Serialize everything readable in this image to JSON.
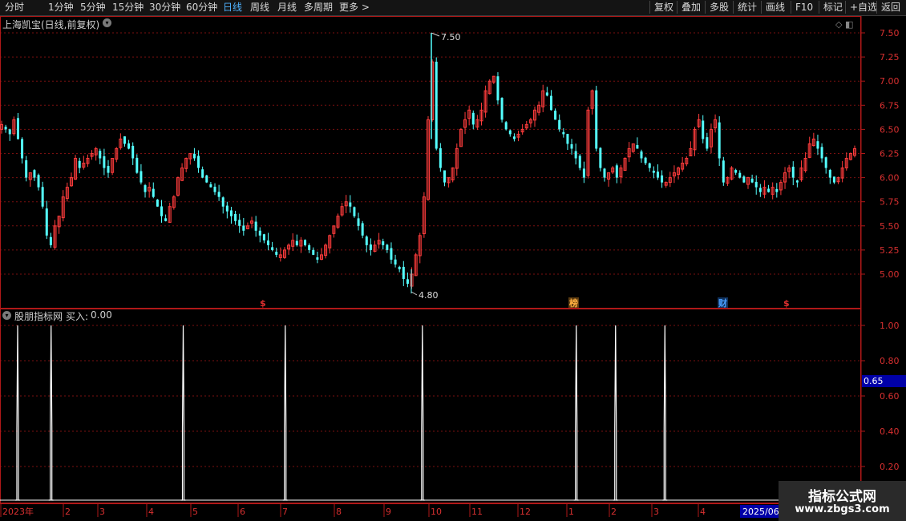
{
  "toolbar": {
    "periods": [
      "分时",
      "1分钟",
      "5分钟",
      "15分钟",
      "30分钟",
      "60分钟",
      "日线",
      "周线",
      "月线",
      "多周期",
      "更多 >"
    ],
    "active_period": "日线",
    "actions": [
      "复权",
      "叠加",
      "多股",
      "统计",
      "画线",
      "F10",
      "标记",
      "+自选",
      "返回"
    ]
  },
  "stock": {
    "title": "上海凯宝(日线,前复权)"
  },
  "indicator": {
    "name": "股朋指标网",
    "label": "买入:",
    "value": "0.00",
    "cursor_value": "0.65"
  },
  "markers": {
    "high_label": "7.50",
    "low_label": "4.80",
    "events": [
      {
        "text": "$",
        "color": "#e03030"
      },
      {
        "text": "榜",
        "color": "#ffb040"
      },
      {
        "text": "财",
        "color": "#4aa0ff"
      },
      {
        "text": "$",
        "color": "#e03030"
      }
    ]
  },
  "axis": {
    "price_ticks": [
      "7.50",
      "7.25",
      "7.00",
      "6.75",
      "6.50",
      "6.25",
      "6.00",
      "5.75",
      "5.50",
      "5.25",
      "5.00"
    ],
    "indicator_ticks": [
      "1.00",
      "0.80",
      "0.60",
      "0.40",
      "0.20"
    ],
    "months": [
      "2023年",
      "2",
      "3",
      "4",
      "5",
      "6",
      "7",
      "8",
      "9",
      "10",
      "11",
      "12",
      "1",
      "2",
      "3",
      "4"
    ],
    "cursor_date": "2025/06/"
  },
  "watermark": {
    "line1": "指标公式网",
    "line2": "www.zbgs3.com"
  },
  "colors": {
    "up": "#ff3c3c",
    "down": "#54ffff",
    "grid": "#7a1010",
    "frame": "#b01818",
    "indicator_line": "#ffffff"
  },
  "chart_data": {
    "type": "candlestick",
    "price_range": [
      4.8,
      7.5
    ],
    "indicator_range": [
      0,
      1
    ],
    "close_path": [
      6.55,
      6.5,
      6.45,
      6.6,
      6.4,
      6.2,
      6.0,
      6.05,
      6.0,
      5.9,
      5.7,
      5.4,
      5.3,
      5.5,
      5.6,
      5.8,
      5.9,
      6.0,
      6.2,
      6.1,
      6.15,
      6.2,
      6.25,
      6.3,
      6.2,
      6.1,
      6.05,
      6.2,
      6.3,
      6.4,
      6.35,
      6.3,
      6.2,
      6.05,
      5.95,
      5.85,
      5.9,
      5.8,
      5.7,
      5.6,
      5.55,
      5.7,
      5.8,
      6.0,
      6.1,
      6.2,
      6.25,
      6.2,
      6.1,
      6.0,
      5.95,
      5.9,
      5.85,
      5.8,
      5.7,
      5.65,
      5.6,
      5.55,
      5.5,
      5.45,
      5.5,
      5.55,
      5.45,
      5.4,
      5.35,
      5.3,
      5.25,
      5.2,
      5.2,
      5.25,
      5.3,
      5.35,
      5.3,
      5.35,
      5.3,
      5.25,
      5.2,
      5.15,
      5.2,
      5.3,
      5.4,
      5.5,
      5.6,
      5.7,
      5.75,
      5.7,
      5.6,
      5.5,
      5.4,
      5.3,
      5.25,
      5.3,
      5.35,
      5.3,
      5.25,
      5.15,
      5.1,
      5.05,
      4.95,
      4.9,
      5.0,
      5.2,
      5.4,
      5.8,
      6.6,
      7.2,
      6.3,
      6.1,
      5.95,
      6.0,
      6.1,
      6.3,
      6.5,
      6.6,
      6.7,
      6.55,
      6.6,
      6.7,
      6.9,
      7.0,
      7.05,
      6.8,
      6.6,
      6.5,
      6.45,
      6.4,
      6.45,
      6.5,
      6.55,
      6.6,
      6.7,
      6.75,
      6.9,
      6.85,
      6.7,
      6.6,
      6.5,
      6.45,
      6.35,
      6.3,
      6.2,
      6.1,
      6.0,
      6.7,
      6.9,
      6.3,
      6.1,
      6.0,
      6.05,
      6.1,
      6.0,
      6.1,
      6.2,
      6.3,
      6.35,
      6.3,
      6.2,
      6.15,
      6.1,
      6.05,
      6.0,
      5.95,
      5.95,
      6.0,
      6.05,
      6.1,
      6.15,
      6.2,
      6.3,
      6.5,
      6.6,
      6.4,
      6.3,
      6.5,
      6.6,
      6.2,
      5.95,
      6.0,
      6.1,
      6.05,
      6.0,
      5.95,
      6.0,
      5.95,
      5.9,
      5.85,
      5.9,
      5.85,
      5.9,
      5.85,
      5.95,
      6.05,
      6.1,
      6.0,
      5.95,
      6.1,
      6.2,
      6.35,
      6.4,
      6.3,
      6.2,
      6.1,
      6.0,
      5.95,
      6.0,
      6.1,
      6.2,
      6.25,
      6.3
    ],
    "close_path_x_start": 2,
    "close_path_x_end": 1066,
    "signals": [
      {
        "position": 0.0,
        "value": 1.0
      },
      {
        "position": 0.04,
        "value": 1.0
      },
      {
        "position": 0.198,
        "value": 1.0
      },
      {
        "position": 0.32,
        "value": 1.0
      },
      {
        "position": 0.484,
        "value": 1.0
      },
      {
        "position": 0.668,
        "value": 1.0
      },
      {
        "position": 0.715,
        "value": 1.0
      },
      {
        "position": 0.774,
        "value": 1.0
      }
    ]
  }
}
